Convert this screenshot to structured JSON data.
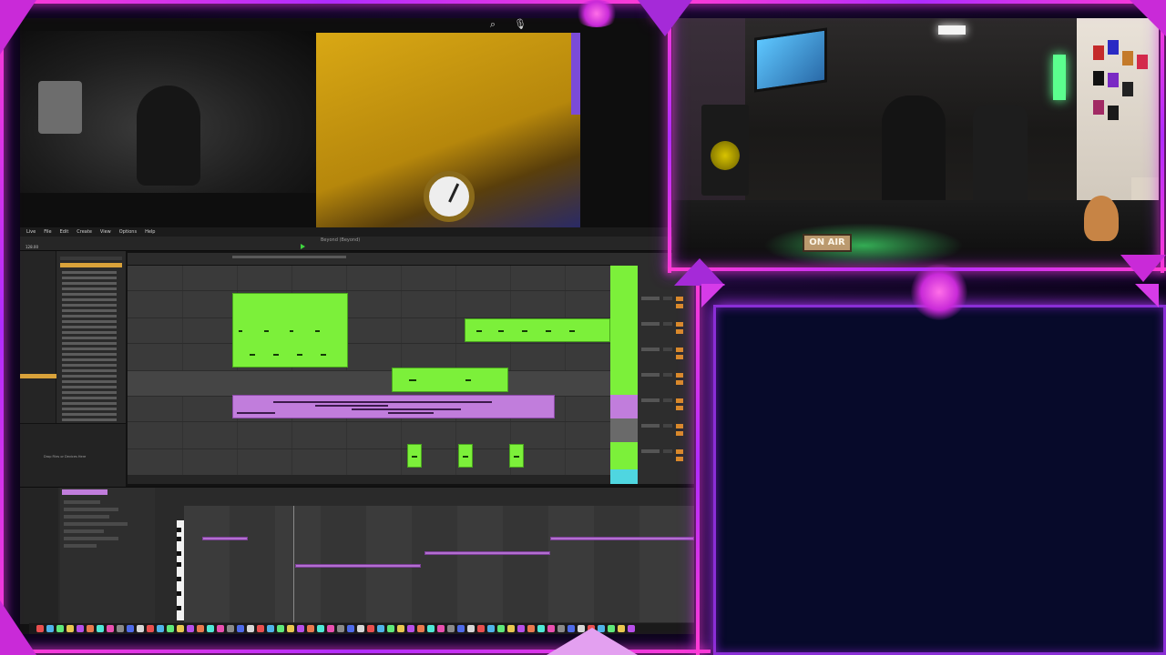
{
  "daw": {
    "menu": [
      "Live",
      "File",
      "Edit",
      "Create",
      "View",
      "Options",
      "Help"
    ],
    "set_title": "Beyond (Beyond)",
    "tempo": "128.00",
    "drop_hint": "Drop Files or Devices Here"
  },
  "camera": {
    "sign": "ON AIR"
  },
  "colors": {
    "frame_neon": "#ff3bd4",
    "clip_green": "#7cf03a",
    "clip_purple": "#c17ddc",
    "blank_panel": "#070a2a"
  },
  "icons": [
    "search-icon",
    "microphone-icon",
    "play-icon"
  ]
}
